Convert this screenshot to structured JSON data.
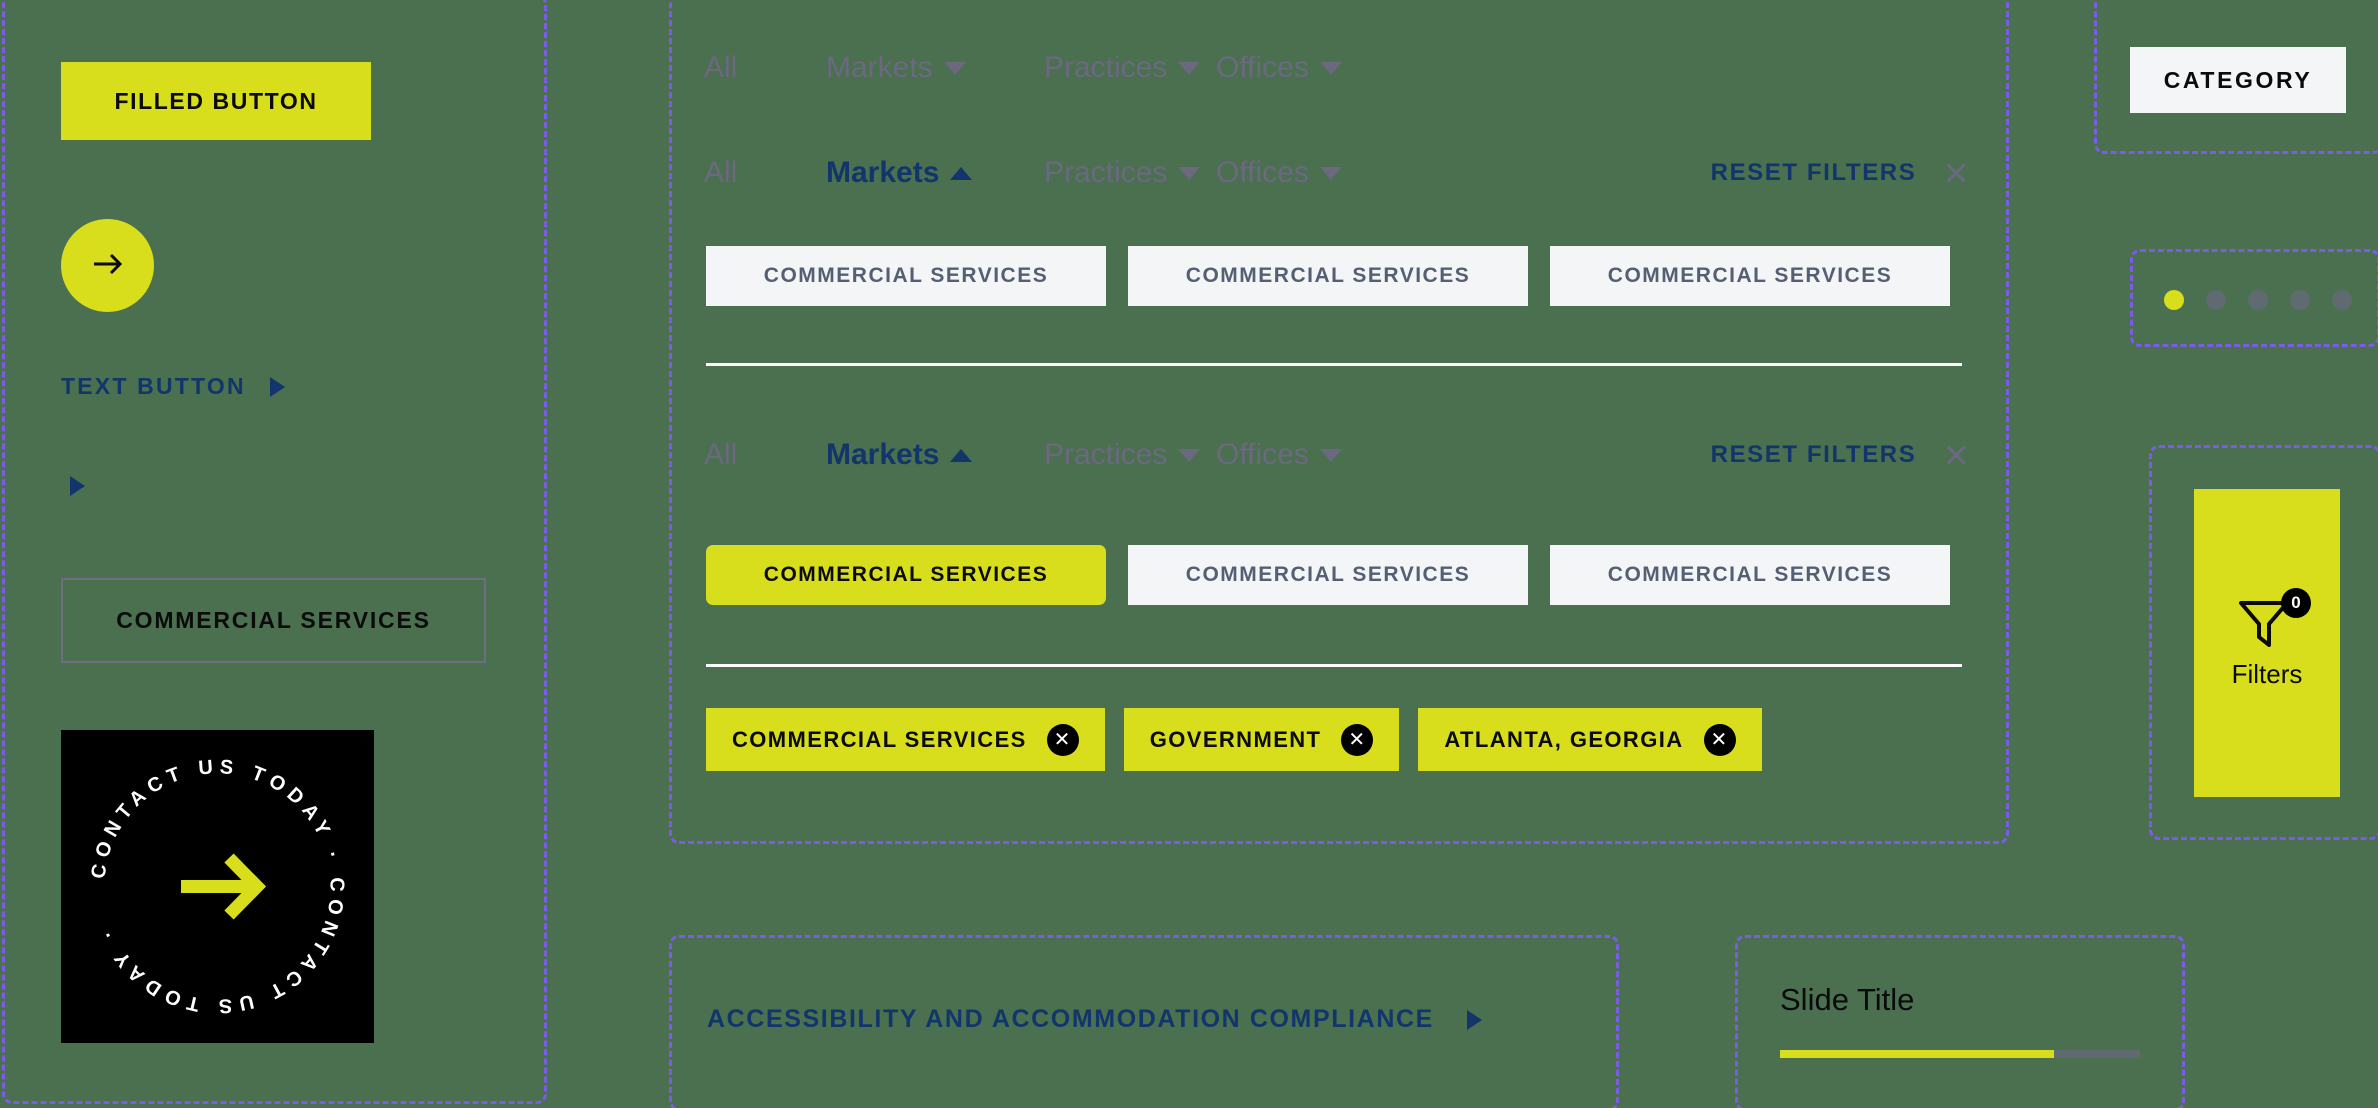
{
  "theme": {
    "background": "#4a7050",
    "accent_yellow": "#d8de1c",
    "navy": "#12356b",
    "muted": "#6b6880",
    "chip_bg": "#f4f5f7",
    "chip_text": "#555f73",
    "guide_purple": "#7c5ce6",
    "black": "#000000",
    "white": "#ffffff"
  },
  "left_column": {
    "filled_button": {
      "label": "FILLED BUTTON"
    },
    "circle_button": {
      "icon": "arrow-right-icon"
    },
    "text_button": {
      "label": "TEXT BUTTON",
      "icon": "triangle-right-icon"
    },
    "icon_only_button": {
      "icon": "triangle-right-icon"
    },
    "outline_button": {
      "label": "COMMERCIAL SERVICES"
    },
    "contact_badge": {
      "ring_text": "CONTACT US TODAY · CONTACT US TODAY · ",
      "icon": "arrow-right-icon"
    }
  },
  "center_panel": {
    "filter_bar_inactive": {
      "items": [
        {
          "label": "All",
          "state": "muted",
          "caret": "none"
        },
        {
          "label": "Markets",
          "state": "muted",
          "caret": "down"
        },
        {
          "label": "Practices",
          "state": "muted",
          "caret": "down"
        },
        {
          "label": "Offices",
          "state": "muted",
          "caret": "down"
        }
      ]
    },
    "filter_bar_a": {
      "items": [
        {
          "label": "All",
          "state": "muted",
          "caret": "none"
        },
        {
          "label": "Markets",
          "state": "active",
          "caret": "up"
        },
        {
          "label": "Practices",
          "state": "muted",
          "caret": "down"
        },
        {
          "label": "Offices",
          "state": "muted",
          "caret": "down"
        }
      ],
      "reset_label": "RESET FILTERS",
      "reset_icon": "close-icon"
    },
    "filter_bar_b": {
      "items": [
        {
          "label": "All",
          "state": "muted",
          "caret": "none"
        },
        {
          "label": "Markets",
          "state": "active",
          "caret": "up"
        },
        {
          "label": "Practices",
          "state": "muted",
          "caret": "down"
        },
        {
          "label": "Offices",
          "state": "muted",
          "caret": "down"
        }
      ],
      "reset_label": "RESET FILTERS",
      "reset_icon": "close-icon"
    },
    "chip_row_1": [
      {
        "label": "COMMERCIAL SERVICES",
        "selected": false
      },
      {
        "label": "COMMERCIAL SERVICES",
        "selected": false
      },
      {
        "label": "COMMERCIAL SERVICES",
        "selected": false
      }
    ],
    "chip_row_2": [
      {
        "label": "COMMERCIAL SERVICES",
        "selected": true
      },
      {
        "label": "COMMERCIAL SERVICES",
        "selected": false
      },
      {
        "label": "COMMERCIAL SERVICES",
        "selected": false
      }
    ],
    "selected_tags": [
      {
        "label": "COMMERCIAL SERVICES",
        "remove_icon": "close-icon"
      },
      {
        "label": "GOVERNMENT",
        "remove_icon": "close-icon"
      },
      {
        "label": "ATLANTA, GEORGIA",
        "remove_icon": "close-icon"
      }
    ]
  },
  "right_column": {
    "category_badge": {
      "label": "CATEGORY"
    },
    "pagination": {
      "total": 5,
      "active_index": 0
    },
    "filters_button": {
      "label": "Filters",
      "count": "0",
      "icon": "funnel-icon"
    }
  },
  "bottom": {
    "accordion": {
      "label": "ACCESSIBILITY AND ACCOMMODATION COMPLIANCE",
      "icon": "triangle-right-icon"
    },
    "slide": {
      "title": "Slide Title",
      "progress_percent": 76
    }
  }
}
